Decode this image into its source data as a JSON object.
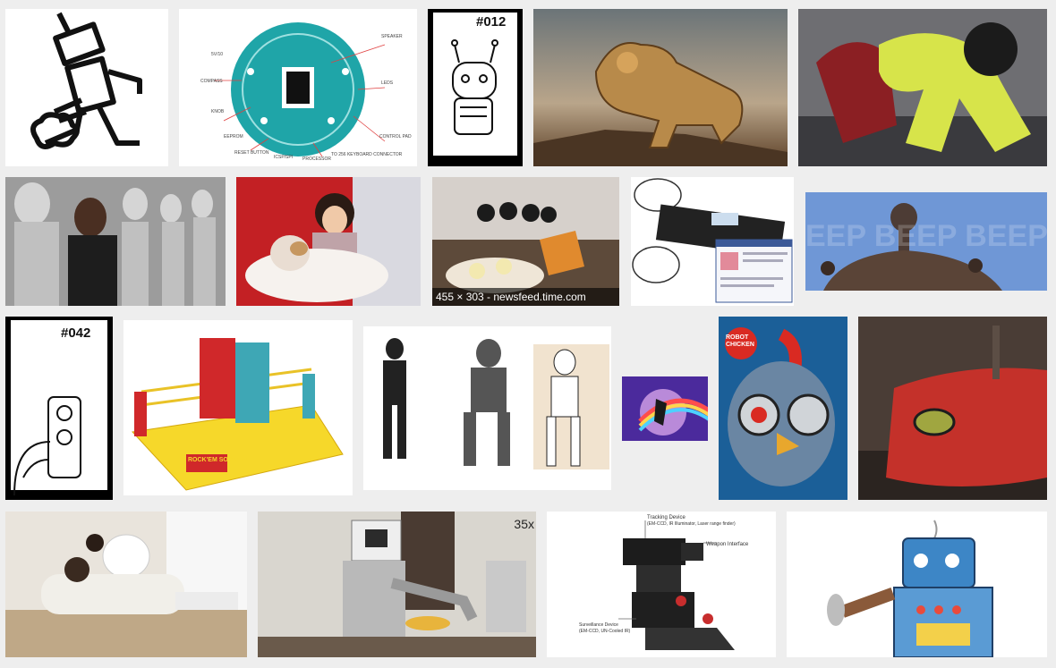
{
  "results": [
    {
      "name": "cartoon-robot-kick",
      "hover_text": ""
    },
    {
      "name": "arduino-robot-board",
      "labels": [
        "SPEAKER",
        "LEDS",
        "CONTROL PAD",
        "TO 256 KEYBOARD CONNECTOR",
        "PROCESSOR",
        "ICSP/SPI",
        "RESET BUTTON",
        "EEPROM",
        "KNOB",
        "COMPASS",
        "5V/10"
      ]
    },
    {
      "name": "robot-sketch-012",
      "number": "#012"
    },
    {
      "name": "steampunk-lion",
      "hover_text": ""
    },
    {
      "name": "dancing-robot-costume",
      "hover_text": ""
    },
    {
      "name": "irobot-movie",
      "hover_text": ""
    },
    {
      "name": "robot-cat-pet",
      "hover_text": ""
    },
    {
      "name": "robot-restaurant",
      "overlay": "455 × 303 - newsfeed.time.com"
    },
    {
      "name": "robot-diagram-facebook",
      "hover_text": ""
    },
    {
      "name": "beep-beep-robot",
      "text": "EEP BEEP BEEP BE"
    },
    {
      "name": "robot-sketch-042",
      "number": "#042"
    },
    {
      "name": "rockem-sockem-robots",
      "brand": "ROCK'EM SOCK'EM"
    },
    {
      "name": "humanoid-robots-lineup",
      "hover_text": ""
    },
    {
      "name": "unicorn-rainbow",
      "hover_text": ""
    },
    {
      "name": "robot-chicken",
      "text": "ROBOT CHICKEN"
    },
    {
      "name": "red-robot-eye",
      "hover_text": ""
    },
    {
      "name": "robot-bear-nurse",
      "hover_text": ""
    },
    {
      "name": "kitchen-robot",
      "corner": "35x"
    },
    {
      "name": "military-robot-diagram",
      "labels": [
        "Tracking Device",
        "(EM-CCD, IR Illuminator, Laser range finder)",
        "Weapon Interface",
        "Surveillance Device",
        "(EM-CCD, UN-Cooled IR)"
      ]
    },
    {
      "name": "tin-toy-robot",
      "hover_text": ""
    }
  ],
  "colors": {
    "background": "#eeeeee",
    "overlay": "#000000"
  }
}
